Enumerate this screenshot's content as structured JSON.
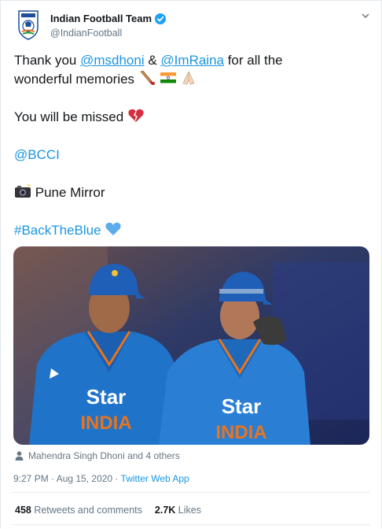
{
  "account": {
    "display_name": "Indian Football Team",
    "handle": "@IndianFootball",
    "verified": true
  },
  "tweet": {
    "line1_prefix": "Thank you ",
    "mention1": "@msdhoni",
    "amp": " & ",
    "mention2": "@ImRaina",
    "line1_suffix": " for all the",
    "line2": "wonderful memories",
    "line3": "You will be missed",
    "mention3": "@BCCI",
    "credit": "Pune Mirror",
    "hashtag": "#BackTheBlue",
    "icons": [
      "cricket-bat-icon",
      "india-flag-icon",
      "folded-hands-icon",
      "broken-heart-icon",
      "camera-icon",
      "blue-heart-icon"
    ]
  },
  "photo": {
    "jersey_text_1": "Star",
    "jersey_text_2": "INDIA"
  },
  "tags": "Mahendra Singh Dhoni and 4 others",
  "meta": {
    "time": "9:27 PM · Aug 15, 2020 · ",
    "source": "Twitter Web App"
  },
  "stats": {
    "retweets_count": "458",
    "retweets_label": " Retweets and comments",
    "likes_count": "2.7K",
    "likes_label": " Likes"
  },
  "colors": {
    "accent": "#1b95e0",
    "secondary_text": "#657786",
    "verified": "#1da1f2",
    "jersey_blue": "#1f73c9"
  }
}
